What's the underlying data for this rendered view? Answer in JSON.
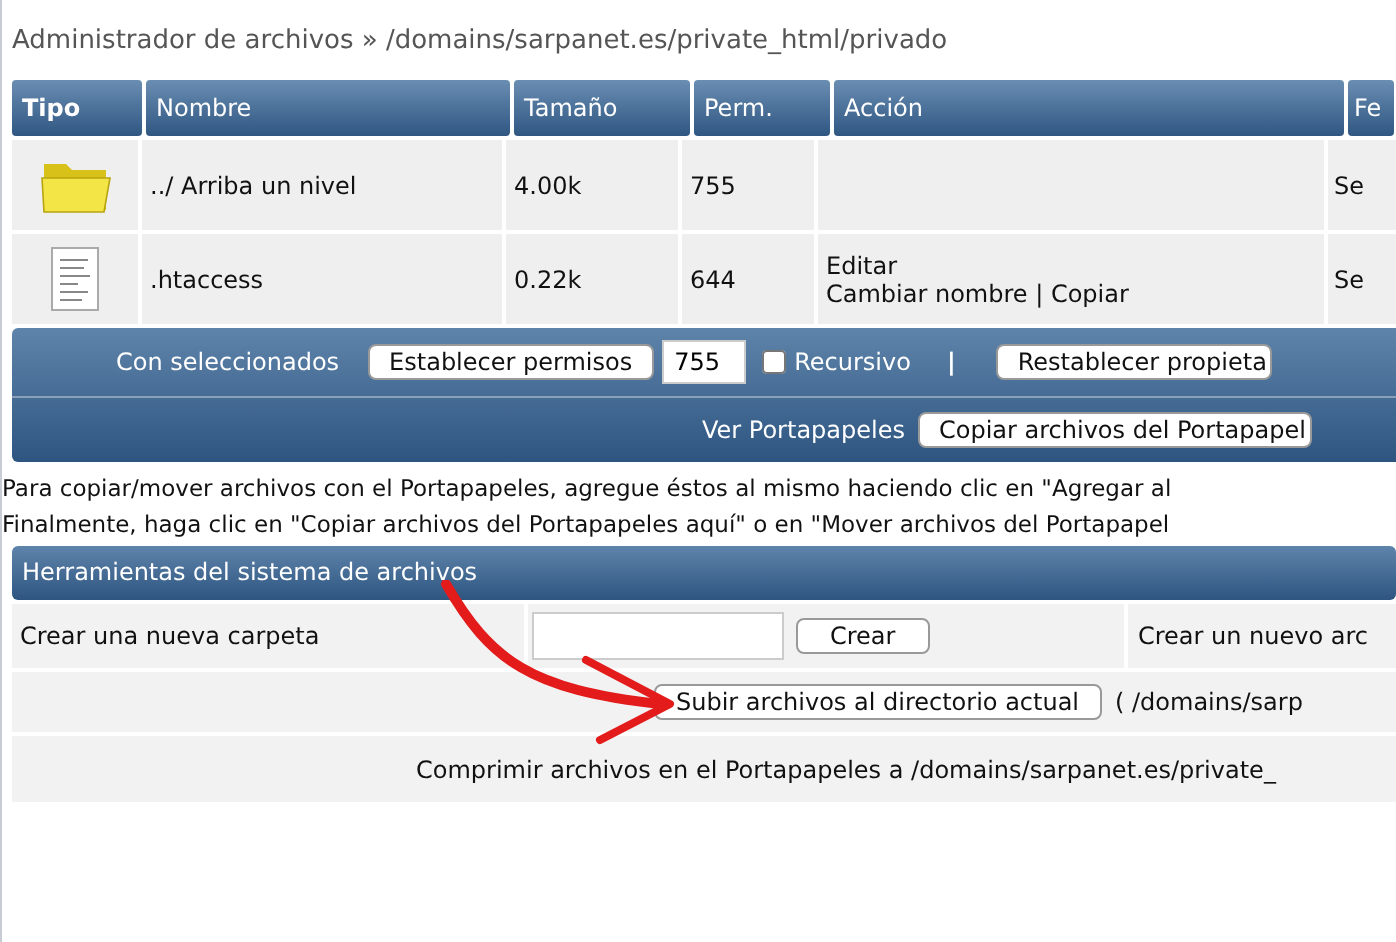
{
  "breadcrumb": "Administrador de archivos » /domains/sarpanet.es/private_html/privado",
  "table": {
    "columns": [
      "Tipo",
      "Nombre",
      "Tamaño",
      "Perm.",
      "Acción",
      "Fe"
    ],
    "rows": [
      {
        "kind": "folder",
        "name": "../ Arriba un nivel",
        "size": "4.00k",
        "perm": "755",
        "actions": [],
        "column_6": "Se"
      },
      {
        "kind": "file",
        "name": ".htaccess",
        "size": "0.22k",
        "perm": "644",
        "actions": [
          "Editar",
          "Cambiar nombre | Copiar"
        ],
        "column_6": "Se"
      }
    ]
  },
  "selection_bar": {
    "label": "Con seleccionados",
    "permissions_button": "Establecer permisos",
    "permissions_value": "755",
    "recursive": {
      "label": "Recursivo",
      "checked": false
    },
    "separator": "|",
    "reset_owner_button": "Restablecer propieta"
  },
  "clipboard_bar": {
    "label": "Ver Portapapeles",
    "button": "Copiar archivos del Portapapel"
  },
  "info": [
    "Para copiar/mover archivos con el Portapapeles, agregue éstos al mismo haciendo clic en \"Agregar al",
    "Finalmente, haga clic en \"Copiar archivos del Portapapeles aquí\" o en \"Mover archivos del Portapapel"
  ],
  "tools": {
    "title": "Herramientas del sistema de archivos",
    "new_folder_label": "Crear una nueva carpeta",
    "new_folder_button": "Crear",
    "new_file_label": "Crear un nuevo arc",
    "upload_button": "Subir archivos al directorio actual",
    "upload_path": "( /domains/sarp",
    "compress_text": "Comprimir archivos en el Portapapeles a /domains/sarpanet.es/private_"
  }
}
